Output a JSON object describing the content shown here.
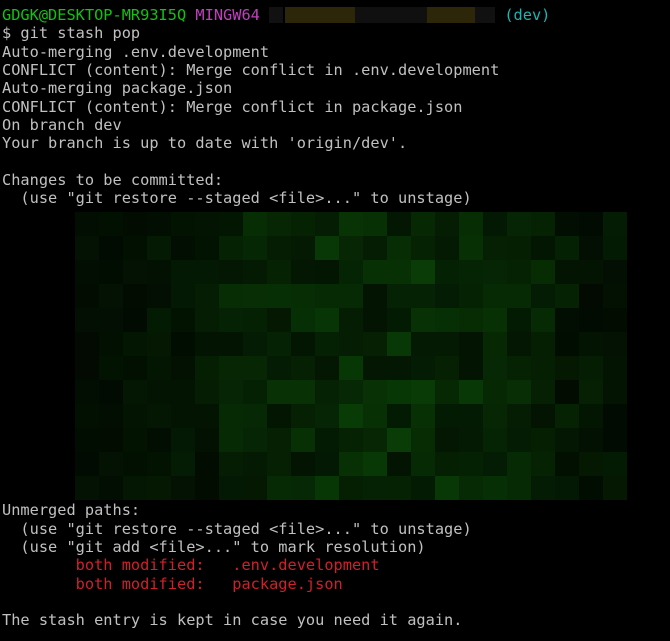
{
  "prompt": {
    "user_host": "GDGK@DESKTOP-MR93I5Q",
    "system": "MINGW64",
    "branch": "(dev)"
  },
  "command": "$ git stash pop",
  "output": [
    "Auto-merging .env.development",
    "CONFLICT (content): Merge conflict in .env.development",
    "Auto-merging package.json",
    "CONFLICT (content): Merge conflict in package.json",
    "On branch dev",
    "Your branch is up to date with 'origin/dev'.",
    "",
    "Changes to be committed:",
    "  (use \"git restore --staged <file>...\" to unstage)"
  ],
  "unmerged": {
    "header": "Unmerged paths:",
    "hints": [
      "  (use \"git restore --staged <file>...\" to unstage)",
      "  (use \"git add <file>...\" to mark resolution)"
    ],
    "files": [
      {
        "status": "        both modified:   ",
        "path": ".env.development"
      },
      {
        "status": "        both modified:   ",
        "path": "package.json"
      }
    ]
  },
  "footer": "The stash entry is kept in case you need it again.",
  "colors": {
    "background": "#000000",
    "text": "#c0c0c0",
    "green": "#13c213",
    "magenta": "#bf40bf",
    "cyan": "#1ab5b5",
    "red": "#d0202a"
  }
}
